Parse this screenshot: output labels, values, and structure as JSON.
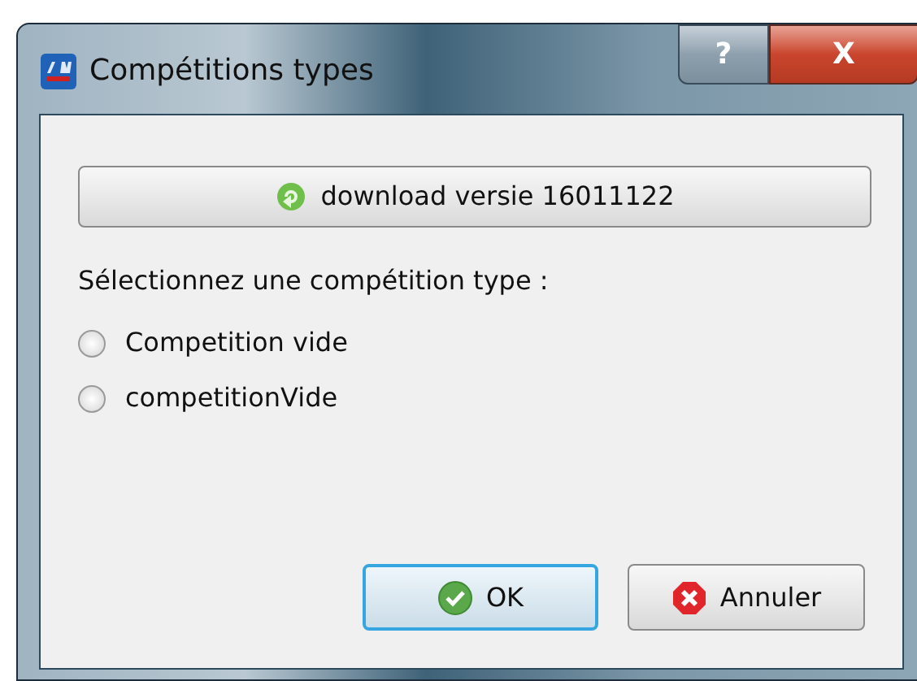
{
  "window": {
    "title": "Compétitions types",
    "help_button": "?",
    "close_button": "X"
  },
  "download_button": {
    "label": "download versie 16011122"
  },
  "prompt": "Sélectionnez une compétition type :",
  "options": [
    {
      "label": "Competition vide",
      "selected": false
    },
    {
      "label": "competitionVide",
      "selected": false
    }
  ],
  "buttons": [
    {
      "kind": "ok",
      "label": "OK",
      "default": true
    },
    {
      "kind": "cancel",
      "label": "Annuler",
      "default": false
    }
  ]
}
